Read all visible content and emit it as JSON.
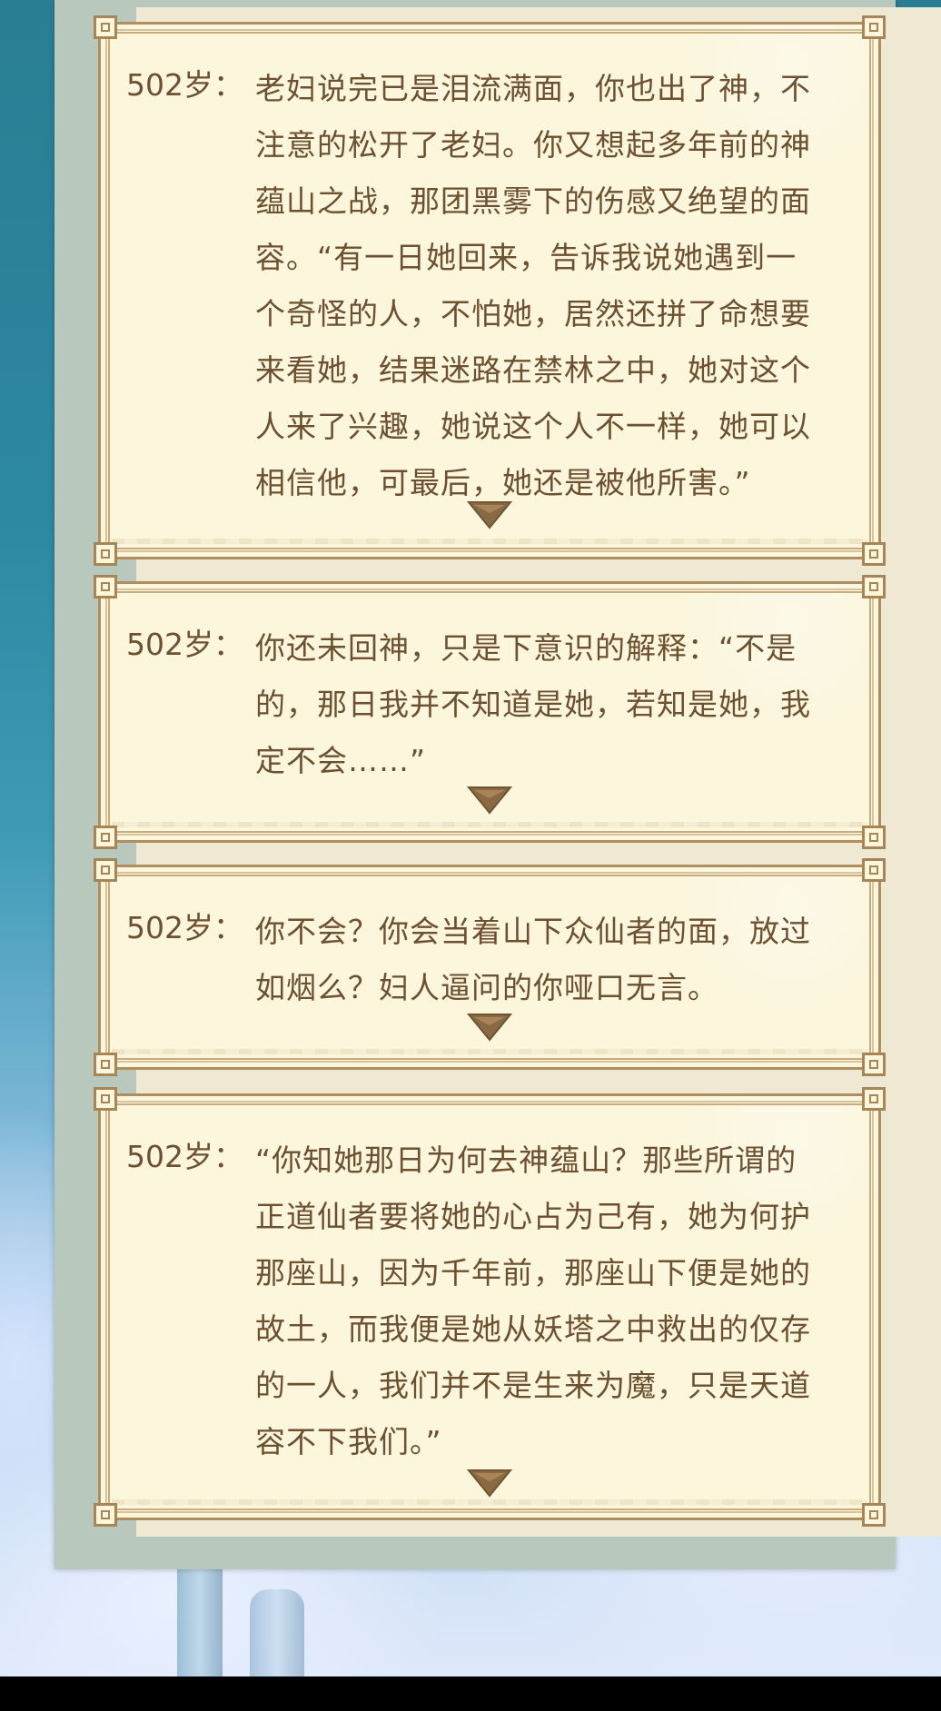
{
  "entries": [
    {
      "age": "502岁：",
      "lines": [
        "老妇说完已是泪流满面，你也出了神，不",
        "注意的松开了老妇。你又想起多年前的神",
        "蕴山之战，那团黑雾下的伤感又绝望的面",
        "容。“有一日她回来，告诉我说她遇到一",
        "个奇怪的人，不怕她，居然还拼了命想要",
        "来看她，结果迷路在禁林之中，她对这个",
        "人来了兴趣，她说这个人不一样，她可以",
        "相信他，可最后，她还是被他所害。”"
      ]
    },
    {
      "age": "502岁：",
      "lines": [
        "你还未回神，只是下意识的解释：“不是",
        "的，那日我并不知道是她，若知是她，我",
        "定不会……”"
      ]
    },
    {
      "age": "502岁：",
      "lines": [
        "你不会？你会当着山下众仙者的面，放过",
        "如烟么？妇人逼问的你哑口无言。"
      ]
    },
    {
      "age": "502岁：",
      "lines": [
        "“你知她那日为何去神蕴山？那些所谓的",
        "正道仙者要将她的心占为己有，她为何护",
        "那座山，因为千年前，那座山下便是她的",
        "故土，而我便是她从妖塔之中救出的仅存",
        "的一人，我们并不是生来为魔，只是天道",
        "容不下我们。”"
      ]
    }
  ],
  "icons": {
    "continue": "triangle-down-icon"
  },
  "colors": {
    "text": "#6d5031",
    "card_bg": "#fbf6dc",
    "border": "#b08d5c",
    "arrow": "#8a6a42"
  }
}
